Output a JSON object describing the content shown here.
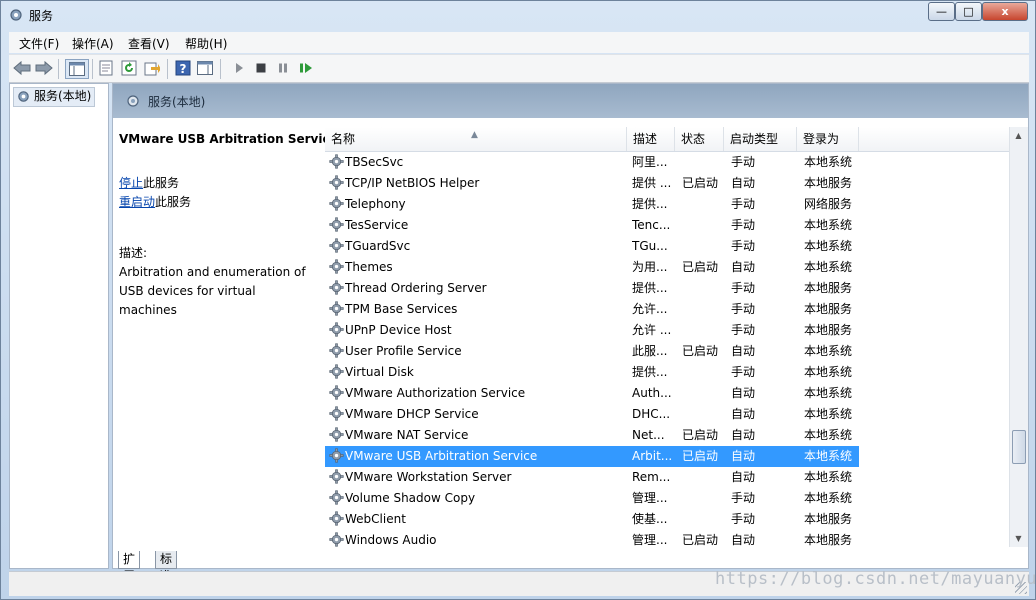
{
  "window": {
    "title": "服务",
    "controls": {
      "minimize": "—",
      "maximize": "□",
      "close": "x"
    }
  },
  "menu": [
    "文件(F)",
    "操作(A)",
    "查看(V)",
    "帮助(H)"
  ],
  "toolbar_icons": [
    "back-arrow-icon",
    "forward-arrow-icon",
    "show-hide-tree-icon",
    "properties-icon",
    "refresh-icon",
    "export-list-icon",
    "help-icon",
    "show-action-pane-icon",
    "start-service-icon",
    "stop-service-icon",
    "pause-service-icon",
    "restart-service-icon"
  ],
  "tree": {
    "root_label": "服务(本地)"
  },
  "header": {
    "title": "服务(本地)"
  },
  "detail": {
    "service_name": "VMware USB Arbitration Service",
    "stop_link": "停止",
    "stop_suffix": "此服务",
    "restart_link": "重启动",
    "restart_suffix": "此服务",
    "desc_label": "描述:",
    "description": "Arbitration and enumeration of USB devices for virtual machines"
  },
  "columns": {
    "name": "名称",
    "desc": "描述",
    "status": "状态",
    "startup": "启动类型",
    "logon": "登录为"
  },
  "services": [
    {
      "name": "TBSecSvc",
      "desc": "阿里...",
      "status": "",
      "startup": "手动",
      "logon": "本地系统"
    },
    {
      "name": "TCP/IP NetBIOS Helper",
      "desc": "提供 ...",
      "status": "已启动",
      "startup": "自动",
      "logon": "本地服务"
    },
    {
      "name": "Telephony",
      "desc": "提供...",
      "status": "",
      "startup": "手动",
      "logon": "网络服务"
    },
    {
      "name": "TesService",
      "desc": "Tenc...",
      "status": "",
      "startup": "手动",
      "logon": "本地系统"
    },
    {
      "name": "TGuardSvc",
      "desc": "TGu...",
      "status": "",
      "startup": "手动",
      "logon": "本地系统"
    },
    {
      "name": "Themes",
      "desc": "为用...",
      "status": "已启动",
      "startup": "自动",
      "logon": "本地系统"
    },
    {
      "name": "Thread Ordering Server",
      "desc": "提供...",
      "status": "",
      "startup": "手动",
      "logon": "本地服务"
    },
    {
      "name": "TPM Base Services",
      "desc": "允许...",
      "status": "",
      "startup": "手动",
      "logon": "本地服务"
    },
    {
      "name": "UPnP Device Host",
      "desc": "允许 ...",
      "status": "",
      "startup": "手动",
      "logon": "本地服务"
    },
    {
      "name": "User Profile Service",
      "desc": "此服...",
      "status": "已启动",
      "startup": "自动",
      "logon": "本地系统"
    },
    {
      "name": "Virtual Disk",
      "desc": "提供...",
      "status": "",
      "startup": "手动",
      "logon": "本地系统"
    },
    {
      "name": "VMware Authorization Service",
      "desc": "Auth...",
      "status": "",
      "startup": "自动",
      "logon": "本地系统"
    },
    {
      "name": "VMware DHCP Service",
      "desc": "DHC...",
      "status": "",
      "startup": "自动",
      "logon": "本地系统"
    },
    {
      "name": "VMware NAT Service",
      "desc": "Net...",
      "status": "已启动",
      "startup": "自动",
      "logon": "本地系统"
    },
    {
      "name": "VMware USB Arbitration Service",
      "desc": "Arbit...",
      "status": "已启动",
      "startup": "自动",
      "logon": "本地系统",
      "selected": true
    },
    {
      "name": "VMware Workstation Server",
      "desc": "Rem...",
      "status": "",
      "startup": "自动",
      "logon": "本地系统"
    },
    {
      "name": "Volume Shadow Copy",
      "desc": "管理...",
      "status": "",
      "startup": "手动",
      "logon": "本地系统"
    },
    {
      "name": "WebClient",
      "desc": "使基...",
      "status": "",
      "startup": "手动",
      "logon": "本地服务"
    },
    {
      "name": "Windows Audio",
      "desc": "管理...",
      "status": "已启动",
      "startup": "自动",
      "logon": "本地服务"
    }
  ],
  "tabs": [
    "扩展",
    "标准"
  ],
  "watermark": "https://blog.csdn.net/mayuanyun",
  "colors": {
    "selection": "#3399ff",
    "link": "#0645ad",
    "header_band": "#9fb3c9"
  }
}
